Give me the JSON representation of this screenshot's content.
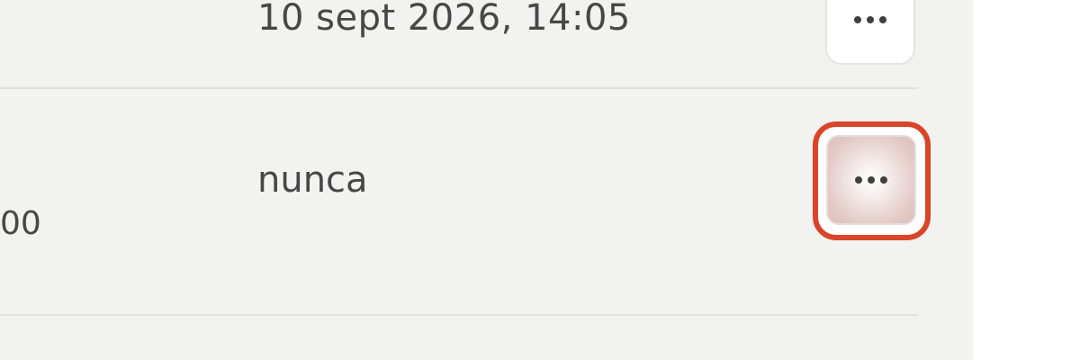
{
  "rows": [
    {
      "date_text": "10 sept 2026, 14:05",
      "actions_icon": "more-horizontal-icon"
    },
    {
      "date_text": "nunca",
      "partial_text": "00",
      "actions_icon": "more-horizontal-icon"
    }
  ],
  "colors": {
    "panel_background": "#f2f2f0",
    "divider": "#e0e0dd",
    "text": "#474747",
    "highlight_ring": "#d9452a"
  }
}
